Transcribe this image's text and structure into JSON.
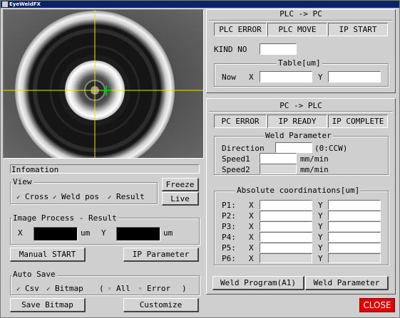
{
  "window": {
    "title": "EyeWeldFX"
  },
  "plc_to_pc": {
    "header": "PLC -> PC",
    "indicators": [
      "PLC ERROR",
      "PLC MOVE",
      "IP START"
    ],
    "kind_label": "KIND NO",
    "kind_value": "",
    "table": {
      "title": "Table[um]",
      "now_label": "Now",
      "x_label": "X",
      "y_label": "Y",
      "x_value": "",
      "y_value": ""
    }
  },
  "pc_to_plc": {
    "header": "PC -> PLC",
    "indicators": [
      "PC ERROR",
      "IP READY",
      "IP COMPLETE"
    ],
    "weld_parameter": {
      "title": "Weld Parameter",
      "direction_label": "Direction",
      "direction_value": "",
      "direction_hint": "(0:CCW)",
      "speed1_label": "Speed1",
      "speed1_value": "",
      "speed1_unit": "mm/min",
      "speed2_label": "Speed2",
      "speed2_value": "",
      "speed2_unit": "mm/min"
    },
    "coords": {
      "title": "Absolute coordinations[um]",
      "x_label": "X",
      "y_label": "Y",
      "rows": [
        {
          "label": "P1:",
          "x": "",
          "y": ""
        },
        {
          "label": "P2:",
          "x": "",
          "y": ""
        },
        {
          "label": "P3:",
          "x": "",
          "y": ""
        },
        {
          "label": "P4:",
          "x": "",
          "y": ""
        },
        {
          "label": "P5:",
          "x": "",
          "y": ""
        },
        {
          "label": "P6:",
          "x": "",
          "y": ""
        }
      ]
    },
    "weld_program_button": "Weld Program(A1)",
    "weld_parameter_button": "Weld Parameter"
  },
  "info": {
    "title": "Infomation",
    "view": {
      "title": "View",
      "cross": "Cross",
      "weld_pos": "Weld pos",
      "result": "Result"
    },
    "freeze_button": "Freeze",
    "live_button": "Live",
    "image_process": {
      "title": "Image Process - Result",
      "x_label": "X",
      "y_label": "Y",
      "unit": "um",
      "x_value": "",
      "y_value": ""
    },
    "manual_start_button": "Manual START",
    "ip_parameter_button": "IP Parameter",
    "auto_save": {
      "title": "Auto Save",
      "csv": "Csv",
      "bitmap": "Bitmap",
      "paren_open": "(",
      "all": "All",
      "error": "Error",
      "paren_close": ")"
    },
    "save_bitmap_button": "Save Bitmap",
    "customize_button": "Customize"
  },
  "close_button": "CLOSE",
  "colors": {
    "title_bar": "#0a246a",
    "close": "#e00000",
    "crosshair": "#e8e800",
    "weld_marker": "#00c000"
  }
}
